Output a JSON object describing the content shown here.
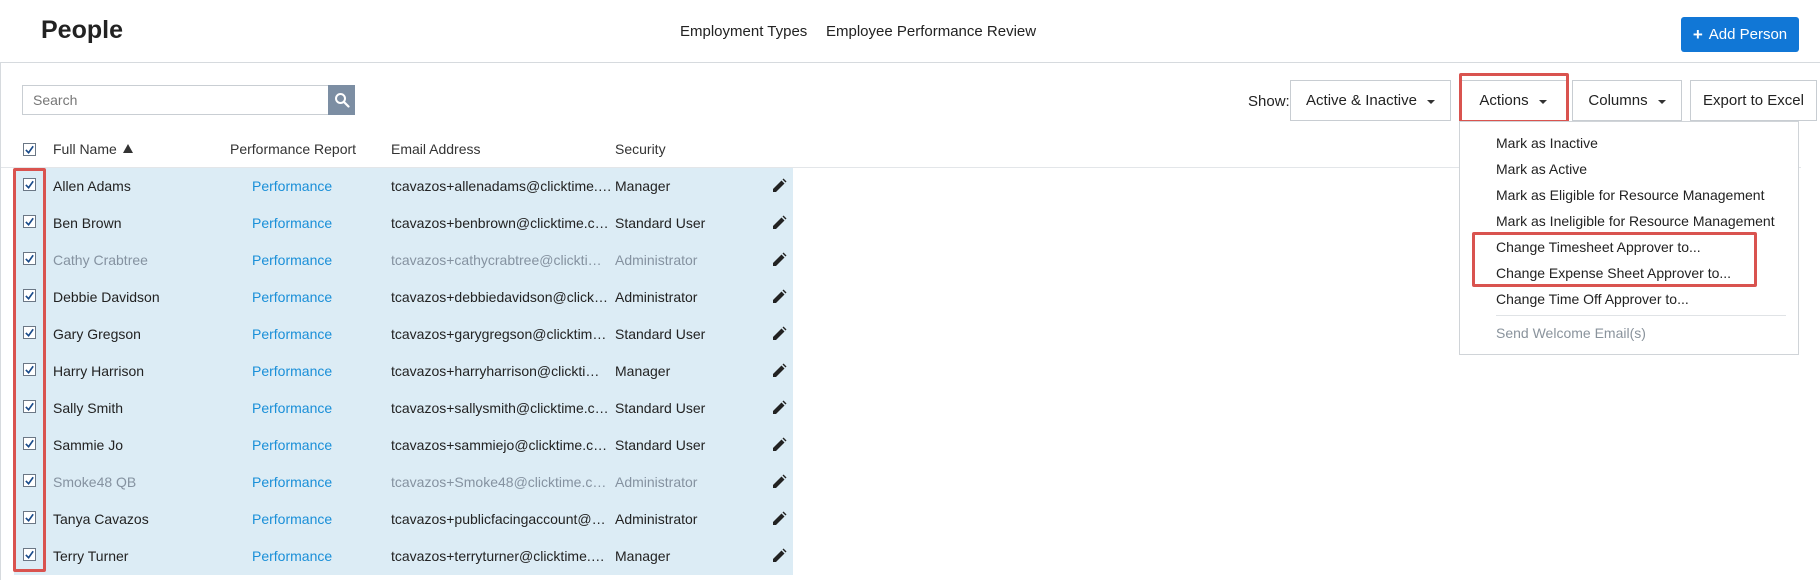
{
  "header": {
    "title": "People",
    "links": [
      "Employment Types",
      "Employee Performance Review"
    ],
    "add_button": {
      "icon": "plus-icon",
      "label": "Add Person"
    }
  },
  "toolbar": {
    "search": {
      "placeholder": "Search",
      "value": "",
      "icon": "search-icon"
    },
    "show_label": "Show:",
    "filter_selected": "Active & Inactive",
    "actions_label": "Actions",
    "columns_label": "Columns",
    "export_label": "Export to Excel"
  },
  "table": {
    "columns": [
      "Full Name",
      "Performance Report",
      "Email Address",
      "Security"
    ],
    "sorted_column": "Full Name",
    "sort_direction": "ascending",
    "rows": [
      {
        "name": "Allen Adams",
        "report": "Performance",
        "email": "tcavazos+allenadams@clicktime.…",
        "security": "Manager",
        "inactive": false
      },
      {
        "name": "Ben Brown",
        "report": "Performance",
        "email": "tcavazos+benbrown@clicktime.c…",
        "security": "Standard User",
        "inactive": false
      },
      {
        "name": "Cathy Crabtree",
        "report": "Performance",
        "email": "tcavazos+cathycrabtree@clickti…",
        "security": "Administrator",
        "inactive": true
      },
      {
        "name": "Debbie Davidson",
        "report": "Performance",
        "email": "tcavazos+debbiedavidson@click…",
        "security": "Administrator",
        "inactive": false
      },
      {
        "name": "Gary Gregson",
        "report": "Performance",
        "email": "tcavazos+garygregson@clicktim…",
        "security": "Standard User",
        "inactive": false
      },
      {
        "name": "Harry Harrison",
        "report": "Performance",
        "email": "tcavazos+harryharrison@clickti…",
        "security": "Manager",
        "inactive": false
      },
      {
        "name": "Sally Smith",
        "report": "Performance",
        "email": "tcavazos+sallysmith@clicktime.c…",
        "security": "Standard User",
        "inactive": false
      },
      {
        "name": "Sammie Jo",
        "report": "Performance",
        "email": "tcavazos+sammiejo@clicktime.c…",
        "security": "Standard User",
        "inactive": false
      },
      {
        "name": "Smoke48 QB",
        "report": "Performance",
        "email": "tcavazos+Smoke48@clicktime.c…",
        "security": "Administrator",
        "inactive": true
      },
      {
        "name": "Tanya Cavazos",
        "report": "Performance",
        "email": "tcavazos+publicfacingaccount@…",
        "security": "Administrator",
        "inactive": false
      },
      {
        "name": "Terry Turner",
        "report": "Performance",
        "email": "tcavazos+terryturner@clicktime.…",
        "security": "Manager",
        "inactive": false
      }
    ]
  },
  "actions_menu": {
    "items": [
      {
        "label": "Mark as Inactive",
        "disabled": false
      },
      {
        "label": "Mark as Active",
        "disabled": false
      },
      {
        "label": "Mark as Eligible for Resource Management",
        "disabled": false
      },
      {
        "label": "Mark as Ineligible for Resource Management",
        "disabled": false
      },
      {
        "label": "Change Timesheet Approver to...",
        "disabled": false
      },
      {
        "label": "Change Expense Sheet Approver to...",
        "disabled": false
      },
      {
        "label": "Change Time Off Approver to...",
        "disabled": false
      },
      {
        "label": "Send Welcome Email(s)",
        "disabled": true
      }
    ]
  },
  "colors": {
    "primary": "#1177d6",
    "link": "#1a8fd8",
    "selected_row_bg": "#dcecf5",
    "highlight_annotation": "#d9534f",
    "search_button": "#7c8ea3"
  }
}
